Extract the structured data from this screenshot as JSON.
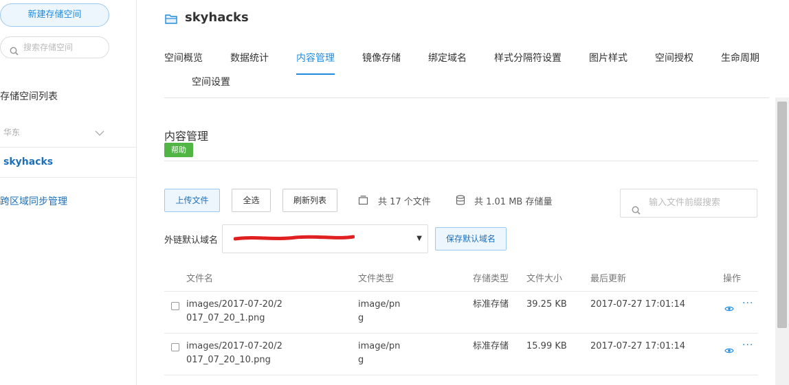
{
  "sidebar": {
    "new_bucket_label": "新建存储空间",
    "search_placeholder": "搜索存储空间",
    "list_title": "存储空间列表",
    "region": "华东",
    "bucket_name": "skyhacks",
    "cross_region_sync": "跨区域同步管理"
  },
  "header": {
    "title": "skyhacks"
  },
  "tabs": [
    {
      "label": "空间概览"
    },
    {
      "label": "数据统计"
    },
    {
      "label": "内容管理"
    },
    {
      "label": "镜像存储"
    },
    {
      "label": "绑定域名"
    },
    {
      "label": "样式分隔符设置"
    },
    {
      "label": "图片样式"
    },
    {
      "label": "空间授权"
    },
    {
      "label": "生命周期"
    },
    {
      "label": "空间设置"
    }
  ],
  "active_tab": "内容管理",
  "section": {
    "title": "内容管理",
    "help_label": "帮助"
  },
  "toolbar": {
    "upload_label": "上传文件",
    "select_all_label": "全选",
    "refresh_label": "刷新列表",
    "file_count_text": "共 17 个文件",
    "storage_text": "共 1.01 MB 存储量",
    "search_placeholder": "输入文件前缀搜索"
  },
  "domain": {
    "label": "外链默认域名",
    "value": "",
    "save_label": "保存默认域名"
  },
  "table": {
    "headers": {
      "name": "文件名",
      "type": "文件类型",
      "storage": "存储类型",
      "size": "文件大小",
      "updated": "最后更新",
      "actions": "操作"
    },
    "rows": [
      {
        "name_line1": "images/2017-07-20/2",
        "name_line2": "017_07_20_1.png",
        "type_line1": "image/pn",
        "type_line2": "g",
        "storage": "标准存储",
        "size": "39.25 KB",
        "updated": "2017-07-27 17:01:14"
      },
      {
        "name_line1": "images/2017-07-20/2",
        "name_line2": "017_07_20_10.png",
        "type_line1": "image/pn",
        "type_line2": "g",
        "storage": "标准存储",
        "size": "15.99 KB",
        "updated": "2017-07-27 17:01:14"
      }
    ]
  },
  "colors": {
    "accent": "#1d8ce0",
    "help_green": "#51b546",
    "redaction": "#e02020"
  }
}
